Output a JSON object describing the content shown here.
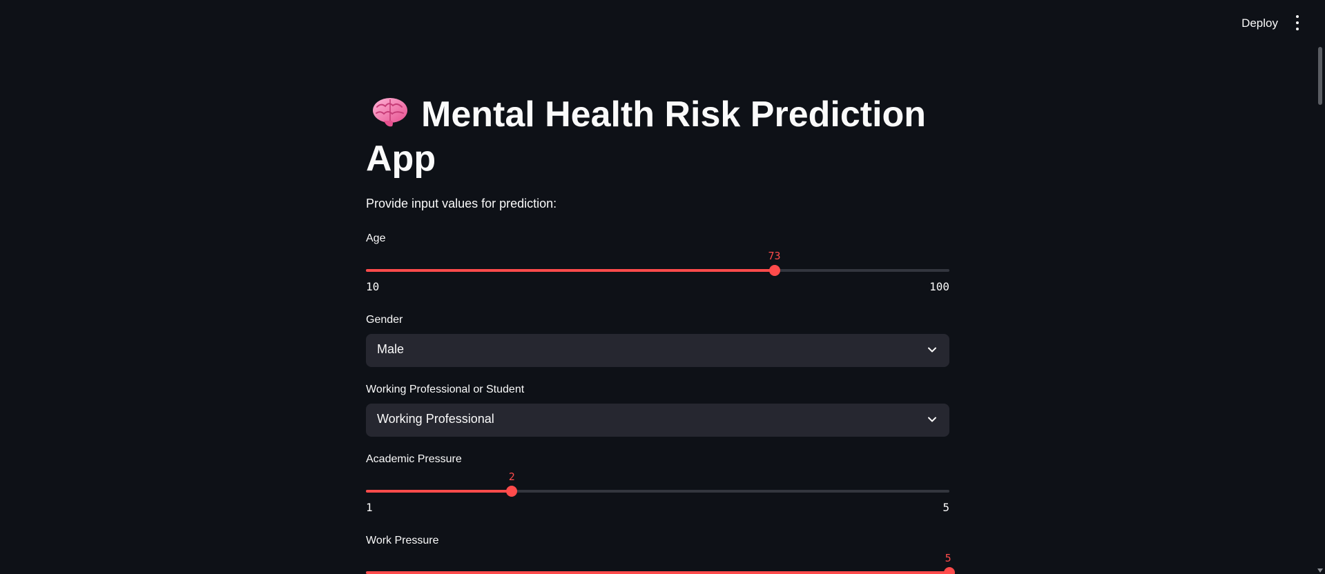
{
  "header": {
    "deploy_label": "Deploy",
    "menu_icon": "vertical-ellipsis-icon"
  },
  "main": {
    "title_icon": "brain-emoji-icon",
    "title": "Mental Health Risk Prediction App",
    "subtitle": "Provide input values for prediction:"
  },
  "fields": {
    "age": {
      "label": "Age",
      "value": 73,
      "value_text": "73",
      "min": 10,
      "max": 100,
      "min_text": "10",
      "max_text": "100"
    },
    "gender": {
      "label": "Gender",
      "value": "Male"
    },
    "role": {
      "label": "Working Professional or Student",
      "value": "Working Professional"
    },
    "academic_pressure": {
      "label": "Academic Pressure",
      "value": 2,
      "value_text": "2",
      "min": 1,
      "max": 5,
      "min_text": "1",
      "max_text": "5"
    },
    "work_pressure": {
      "label": "Work Pressure",
      "value": 5,
      "value_text": "5",
      "min": 1,
      "max": 5
    }
  },
  "colors": {
    "background": "#0e1117",
    "accent": "#ff4b4b",
    "input_bg": "#262730",
    "track": "#33363e",
    "text": "#fafafa"
  }
}
